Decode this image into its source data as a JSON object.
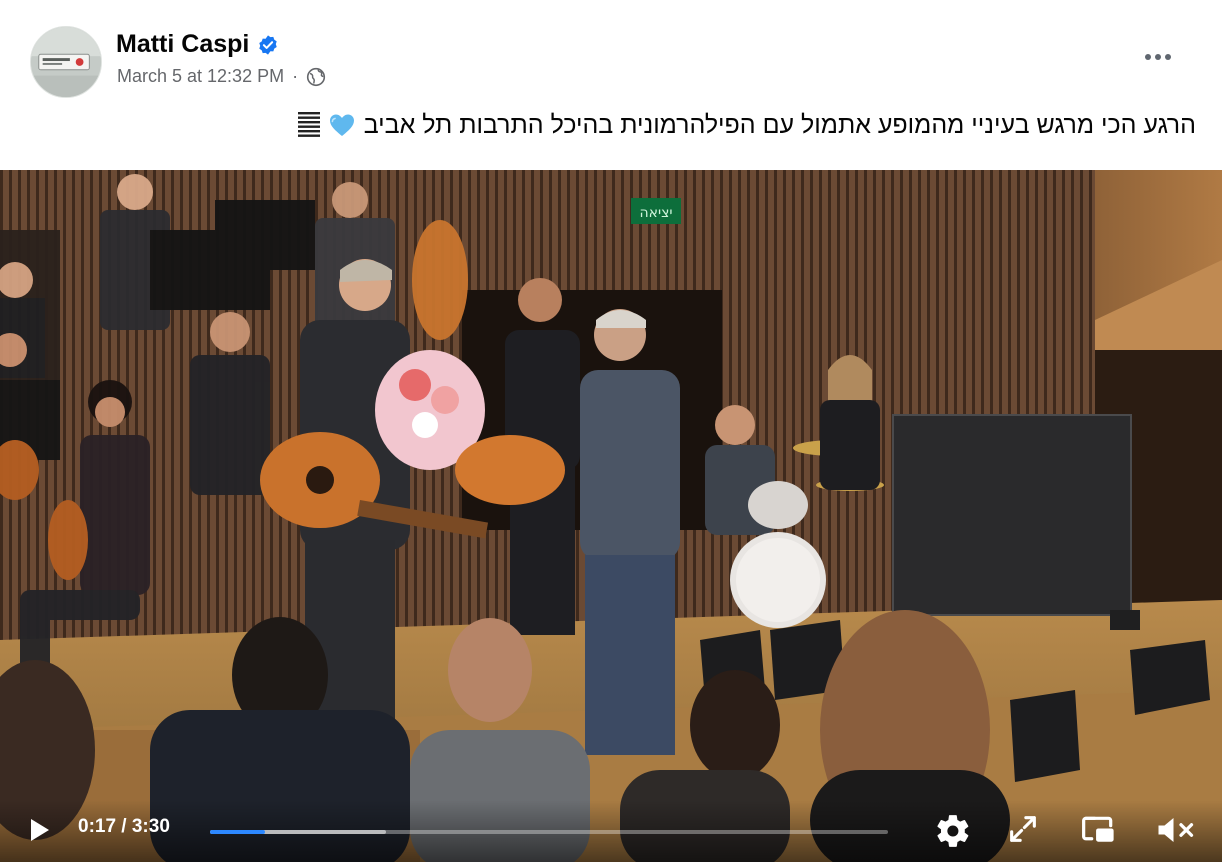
{
  "post": {
    "author": "Matti Caspi",
    "verified": true,
    "timestamp": "March 5 at 12:32 PM",
    "separator": "·",
    "audience_icon": "globe-icon",
    "more_icon": "more-options-icon",
    "caption_text": "הרגע הכי מרגש בעיניי מהמופע אתמול עם הפילהרמונית בהיכל התרבות תל אביב",
    "caption_emojis": [
      "blue-heart-icon",
      "musical-notes-icon"
    ]
  },
  "video": {
    "scene_description_icon": "concert-stage-video",
    "exit_sign": "יציאה",
    "controls": {
      "current_time": "0:17",
      "duration": "3:30",
      "time_text": "0:17 / 3:30",
      "played_fraction": 0.081,
      "buffered_fraction": 0.26,
      "icons": [
        "play-icon",
        "settings-icon",
        "fullscreen-icon",
        "picture-in-picture-icon",
        "mute-icon"
      ]
    }
  },
  "colors": {
    "accent": "#2d88ff",
    "verified_badge": "#1877f2",
    "secondary_text": "#65676b"
  }
}
